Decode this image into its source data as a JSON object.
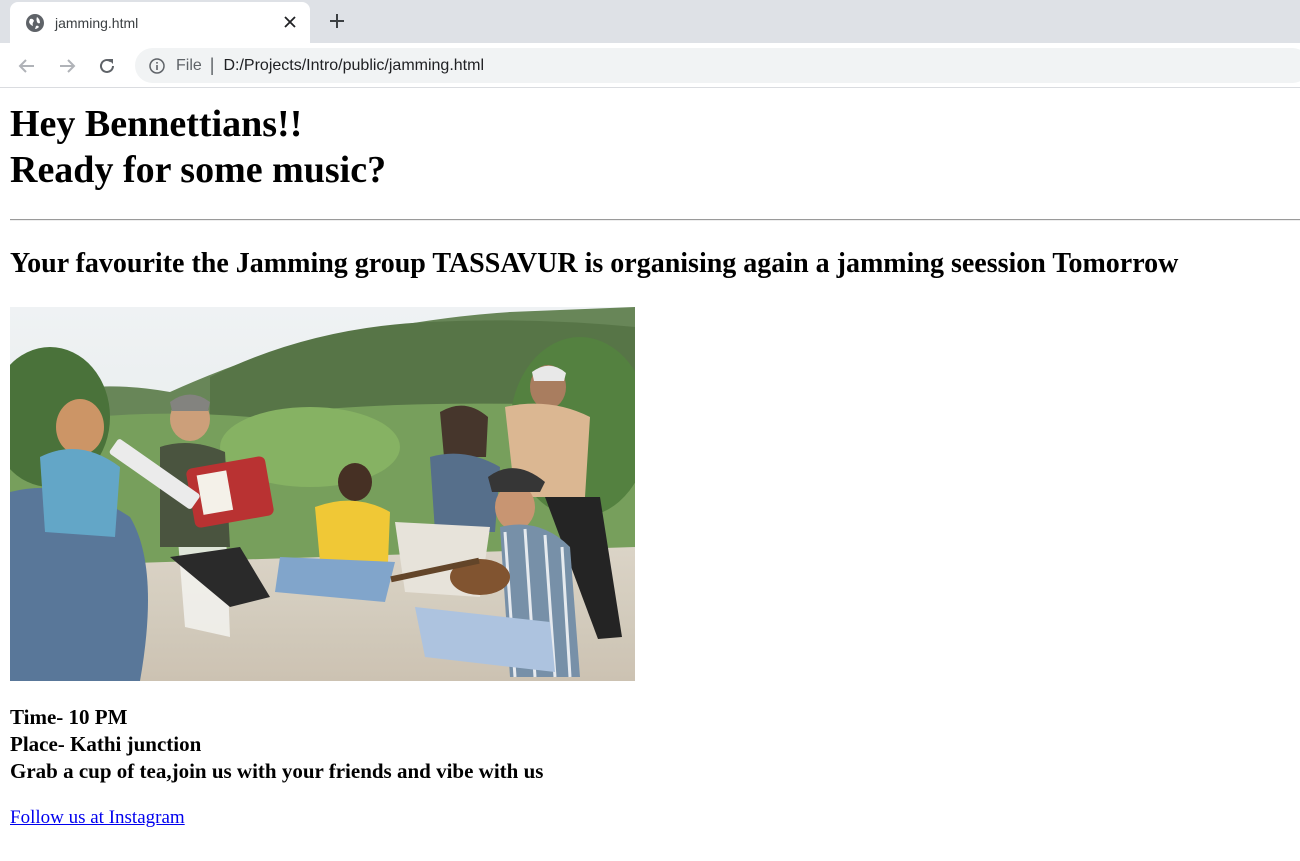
{
  "browser": {
    "tab_title": "jamming.html",
    "address_scheme_label": "File",
    "address_separator": "|",
    "url": "D:/Projects/Intro/public/jamming.html"
  },
  "page": {
    "heading_line1": "Hey Bennettians!!",
    "heading_line2": "Ready for some music?",
    "subheading": "Your favourite the Jamming group TASSAVUR is organising again a jamming seession Tomorrow",
    "details": {
      "time": "Time- 10 PM",
      "place": "Place- Kathi junction",
      "invite": "Grab a cup of tea,join us with your friends and vibe with us"
    },
    "link_text": "Follow us at Instagram"
  },
  "icons": {
    "tab": "globe-icon",
    "tab_close": "close-icon",
    "new_tab": "plus-icon",
    "back": "arrow-left-icon",
    "forward": "arrow-right-icon",
    "reload": "reload-icon",
    "site_info": "info-icon"
  },
  "colors": {
    "tabstrip": "#dee1e6",
    "omnibox": "#f1f3f4",
    "link": "#0000ee"
  }
}
